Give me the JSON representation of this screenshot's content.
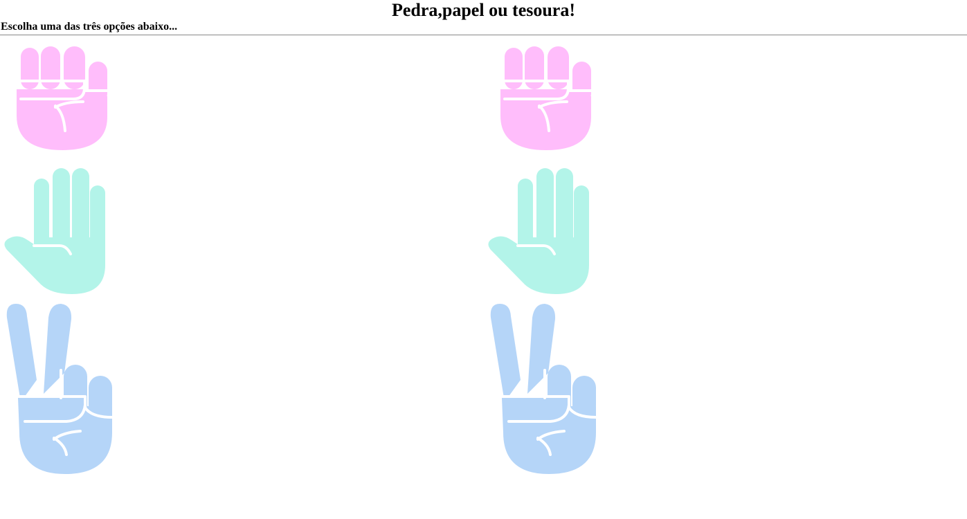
{
  "header": {
    "title": "Pedra,papel ou tesoura!",
    "subtitle": "Escolha uma das três opções abaixo..."
  },
  "colors": {
    "rock": "#ffbdfb",
    "paper": "#b3f4e9",
    "scissors": "#b5d5f8",
    "divider": "#888888"
  },
  "columns": [
    {
      "side": "left",
      "options": [
        {
          "icon": "rock-hand-icon"
        },
        {
          "icon": "paper-hand-icon"
        },
        {
          "icon": "scissors-hand-icon"
        }
      ]
    },
    {
      "side": "right",
      "options": [
        {
          "icon": "rock-hand-icon"
        },
        {
          "icon": "paper-hand-icon"
        },
        {
          "icon": "scissors-hand-icon"
        }
      ]
    }
  ]
}
